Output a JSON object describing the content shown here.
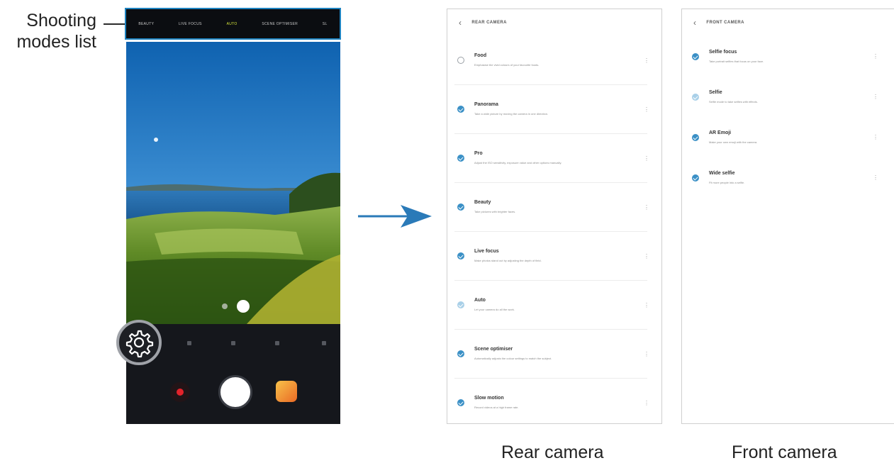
{
  "callout": {
    "line1": "Shooting",
    "line2": "modes list"
  },
  "modes_list": {
    "items": [
      "BEAUTY",
      "LIVE FOCUS",
      "AUTO",
      "SCENE OPTIMISER",
      "SL"
    ],
    "active": "AUTO"
  },
  "rear_panel": {
    "title": "REAR CAMERA",
    "modes": [
      {
        "name": "Food",
        "desc": "Emphasise the vivid colours of your favourite foods.",
        "state": "off"
      },
      {
        "name": "Panorama",
        "desc": "Take a wide picture by moving the camera in one direction.",
        "state": "on"
      },
      {
        "name": "Pro",
        "desc": "Adjust the ISO sensitivity, exposure value and other options manually.",
        "state": "on"
      },
      {
        "name": "Beauty",
        "desc": "Take pictures with brighter faces.",
        "state": "on"
      },
      {
        "name": "Live focus",
        "desc": "Make photos stand out by adjusting the depth of field.",
        "state": "on"
      },
      {
        "name": "Auto",
        "desc": "Let your camera do all the work.",
        "state": "light"
      },
      {
        "name": "Scene optimiser",
        "desc": "Automatically adjusts the colour settings to match the subject.",
        "state": "on"
      },
      {
        "name": "Slow motion",
        "desc": "Record videos at a high frame rate.",
        "state": "on"
      }
    ]
  },
  "front_panel": {
    "title": "FRONT CAMERA",
    "modes": [
      {
        "name": "Selfie focus",
        "desc": "Take portrait selfies that focus on your face.",
        "state": "on"
      },
      {
        "name": "Selfie",
        "desc": "Selfie mode to take selfies with effects.",
        "state": "light"
      },
      {
        "name": "AR Emoji",
        "desc": "Make your own emoji with the camera.",
        "state": "on"
      },
      {
        "name": "Wide selfie",
        "desc": "Fit more people into a selfie.",
        "state": "on"
      }
    ]
  },
  "captions": {
    "rear": "Rear camera",
    "front": "Front camera"
  },
  "colors": {
    "accent_blue": "#1e83c0",
    "arrow": "#2a7ab8",
    "check": "#3b90c6"
  }
}
